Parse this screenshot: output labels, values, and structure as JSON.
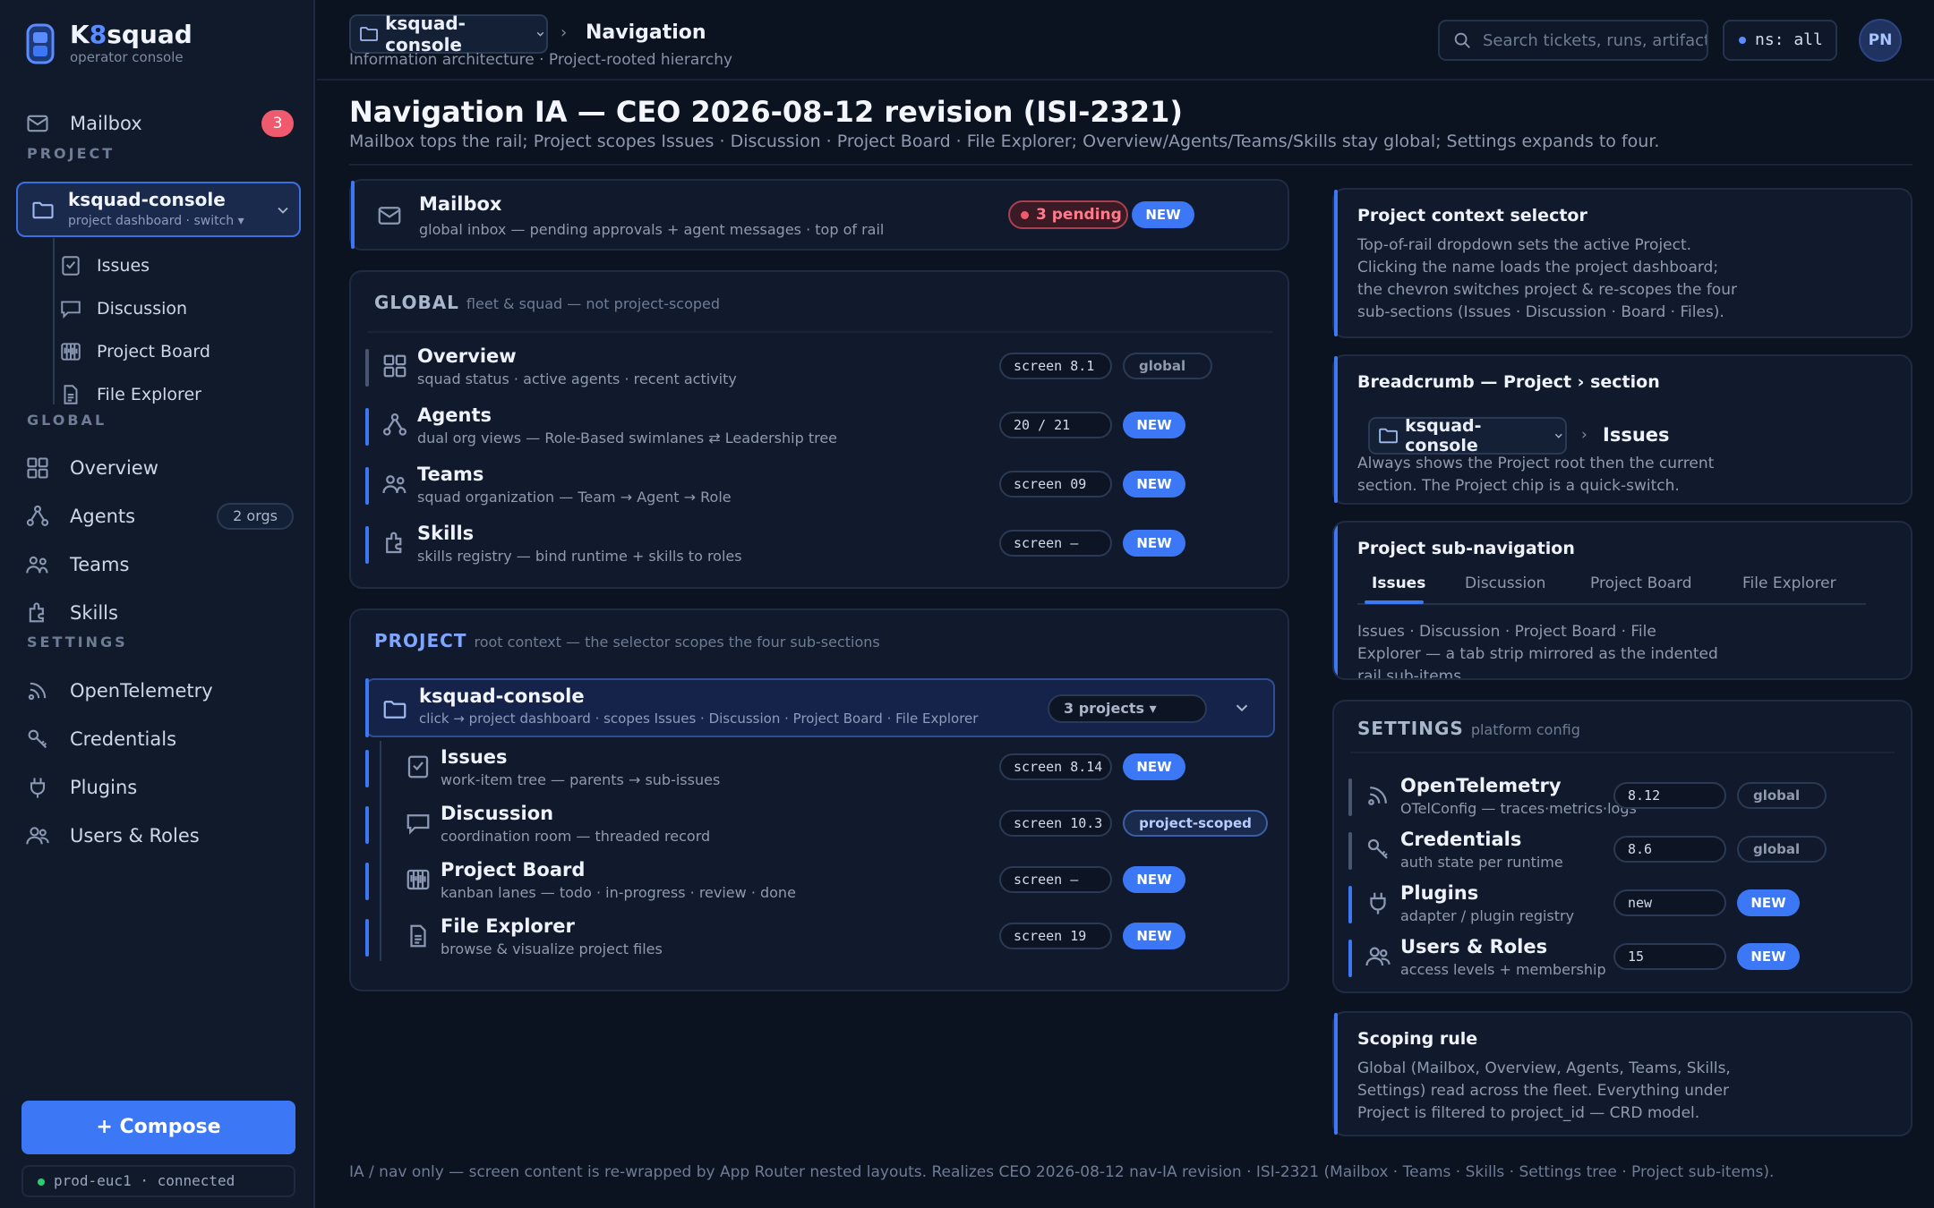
{
  "brand": {
    "name_prefix": "K",
    "name_accent": "8",
    "name_suffix": "squad",
    "subtitle": "operator console"
  },
  "sidebar": {
    "mailbox": {
      "label": "Mailbox",
      "badge": "3"
    },
    "project_section": "PROJECT",
    "project_selector": {
      "name": "ksquad-console",
      "sub": "project dashboard · switch ▾"
    },
    "project_items": [
      {
        "label": "Issues",
        "icon": "issues-icon"
      },
      {
        "label": "Discussion",
        "icon": "discussion-icon"
      },
      {
        "label": "Project Board",
        "icon": "board-icon"
      },
      {
        "label": "File Explorer",
        "icon": "file-icon"
      }
    ],
    "global_section": "GLOBAL",
    "global_items": [
      {
        "label": "Overview",
        "icon": "overview-icon"
      },
      {
        "label": "Agents",
        "icon": "agents-icon",
        "chip": "2 orgs"
      },
      {
        "label": "Teams",
        "icon": "teams-icon"
      },
      {
        "label": "Skills",
        "icon": "skills-icon"
      }
    ],
    "settings_section": "SETTINGS",
    "settings_items": [
      {
        "label": "OpenTelemetry",
        "icon": "telemetry-icon"
      },
      {
        "label": "Credentials",
        "icon": "key-icon"
      },
      {
        "label": "Plugins",
        "icon": "plug-icon"
      },
      {
        "label": "Users & Roles",
        "icon": "users-icon"
      }
    ],
    "compose": "+ Compose",
    "env": "prod-euc1 · connected"
  },
  "header": {
    "crumb_project": "ksquad-console",
    "crumb_sep": "›",
    "crumb_section": "Navigation",
    "crumb_sub": "Information architecture · Project-rooted hierarchy",
    "search_placeholder": "Search tickets, runs, artifacts...",
    "ns": "ns: all",
    "avatar": "PN"
  },
  "page": {
    "title": "Navigation IA — CEO 2026-08-12 revision (ISI-2321)",
    "subtitle": "Mailbox tops the rail; Project scopes Issues · Discussion · Project Board · File Explorer; Overview/Agents/Teams/Skills stay global; Settings expands to four."
  },
  "mailbox_card": {
    "title": "Mailbox",
    "sub": "global inbox — pending approvals + agent messages · top of rail",
    "pending": "3 pending",
    "new": "NEW"
  },
  "global_card": {
    "head": "GLOBAL",
    "head_sub": "fleet & squad — not project-scoped",
    "rows": [
      {
        "title": "Overview",
        "sub": "squad status · active agents · recent activity",
        "tag": "screen 8.1",
        "status": "global"
      },
      {
        "title": "Agents",
        "sub": "dual org views — Role-Based swimlanes ⇄ Leadership tree",
        "tag": "20 / 21",
        "status": "NEW"
      },
      {
        "title": "Teams",
        "sub": "squad organization — Team → Agent → Role",
        "tag": "screen 09",
        "status": "NEW"
      },
      {
        "title": "Skills",
        "sub": "skills registry — bind runtime + skills to roles",
        "tag": "screen –",
        "status": "NEW"
      }
    ]
  },
  "project_card": {
    "head": "PROJECT",
    "head_sub": "root context — the selector scopes the four sub-sections",
    "selector": {
      "title": "ksquad-console",
      "sub": "click → project dashboard · scopes Issues · Discussion · Project Board · File Explorer",
      "count": "3 projects ▾"
    },
    "rows": [
      {
        "title": "Issues",
        "sub": "work-item tree — parents → sub-issues",
        "tag": "screen 8.14",
        "status": "NEW"
      },
      {
        "title": "Discussion",
        "sub": "coordination room — threaded record",
        "tag": "screen 10.3",
        "status": "project-scoped"
      },
      {
        "title": "Project Board",
        "sub": "kanban lanes — todo · in-progress · review · done",
        "tag": "screen –",
        "status": "NEW"
      },
      {
        "title": "File Explorer",
        "sub": "browse & visualize project files",
        "tag": "screen 19",
        "status": "NEW"
      }
    ]
  },
  "right": {
    "ctx": {
      "title": "Project context selector",
      "lines": [
        "Top-of-rail dropdown sets the active Project.",
        "Clicking the name loads the project dashboard;",
        "the chevron switches project & re-scopes the four",
        "sub-sections (Issues · Discussion · Board · Files)."
      ]
    },
    "crumb": {
      "title": "Breadcrumb — Project › section",
      "chip": "ksquad-console",
      "sep": "›",
      "section": "Issues",
      "lines": [
        "Always shows the Project root then the current",
        "section. The Project chip is a quick-switch."
      ]
    },
    "subnav": {
      "title": "Project sub-navigation",
      "tabs": [
        "Issues",
        "Discussion",
        "Project Board",
        "File Explorer"
      ],
      "lines": [
        "Issues · Discussion · Project Board · File",
        "Explorer — a tab strip mirrored as the indented",
        "rail sub-items."
      ]
    },
    "settings": {
      "head": "SETTINGS",
      "head_sub": "platform config",
      "rows": [
        {
          "title": "OpenTelemetry",
          "sub": "OTelConfig — traces·metrics·logs",
          "tag": "8.12",
          "status": "global"
        },
        {
          "title": "Credentials",
          "sub": "auth state per runtime",
          "tag": "8.6",
          "status": "global"
        },
        {
          "title": "Plugins",
          "sub": "adapter / plugin registry",
          "tag": "new",
          "status": "NEW"
        },
        {
          "title": "Users & Roles",
          "sub": "access levels + membership",
          "tag": "15",
          "status": "NEW"
        }
      ]
    },
    "scope": {
      "title": "Scoping rule",
      "lines": [
        "Global (Mailbox, Overview, Agents, Teams, Skills,",
        "Settings) read across the fleet. Everything under",
        "Project is filtered to project_id — CRD model."
      ]
    }
  },
  "footer": "IA / nav only — screen content is re-wrapped by App Router nested layouts. Realizes CEO 2026-08-12 nav-IA revision · ISI-2321 (Mailbox · Teams · Skills · Settings tree · Project sub-items).",
  "colors": {
    "accent": "#3c78f5",
    "background": "#0b1220",
    "danger": "#f05a6e"
  }
}
